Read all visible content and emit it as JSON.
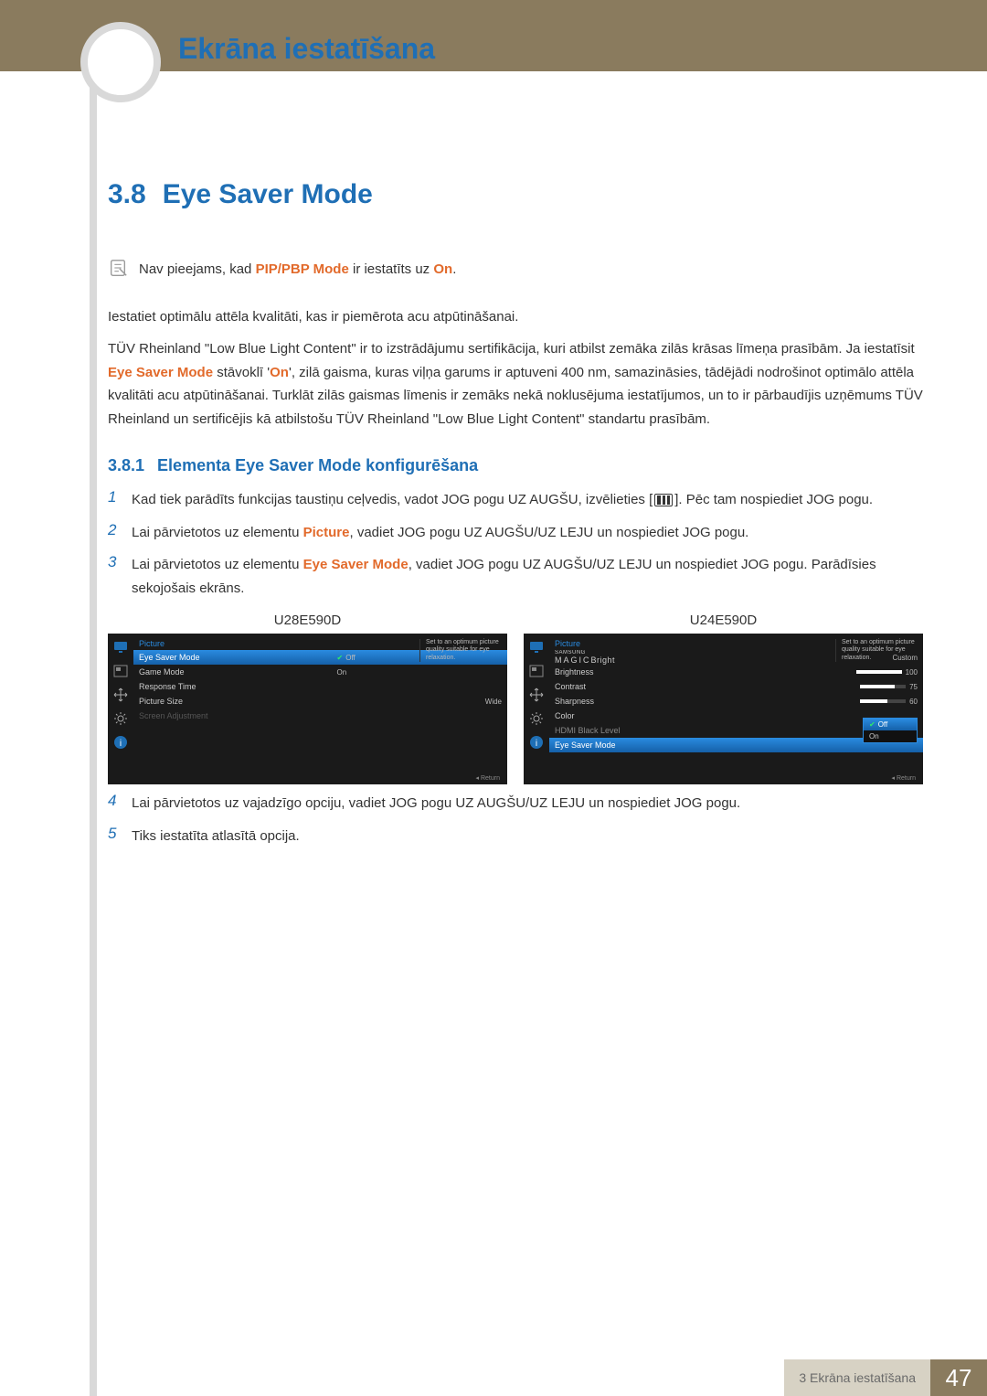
{
  "header": {
    "chapter_title": "Ekrāna iestatīšana"
  },
  "h2": {
    "num": "3.8",
    "title": "Eye Saver Mode"
  },
  "note": {
    "pre": "Nav pieejams, kad ",
    "bold1": "PIP/PBP Mode",
    "mid": " ir iestatīts uz ",
    "bold2": "On",
    "post": "."
  },
  "para1": "Iestatiet optimālu attēla kvalitāti, kas ir piemērota acu atpūtināšanai.",
  "para2": {
    "a": "TÜV Rheinland \"Low Blue Light Content\" ir to izstrādājumu sertifikācija, kuri atbilst zemāka zilās krāsas līmeņa prasībām. Ja iestatīsit ",
    "b": "Eye Saver Mode",
    "c": " stāvoklī '",
    "d": "On",
    "e": "', zilā gaisma, kuras viļņa garums ir aptuveni 400 nm, samazināsies, tādējādi nodrošinot optimālo attēla kvalitāti acu atpūtināšanai. Turklāt zilās gaismas līmenis ir zemāks nekā noklusējuma iestatījumos, un to ir pārbaudījis uzņēmums TÜV Rheinland un sertificējis kā atbilstošu TÜV Rheinland \"Low Blue Light Content\" standartu prasībām."
  },
  "h3": {
    "num": "3.8.1",
    "title": "Elementa Eye Saver Mode konfigurēšana"
  },
  "steps": {
    "s1a": "Kad tiek parādīts funkcijas taustiņu ceļvedis, vadot JOG pogu UZ AUGŠU, izvēlieties [",
    "s1b": "]. Pēc tam nospiediet JOG pogu.",
    "s2a": "Lai pārvietotos uz elementu ",
    "s2b": "Picture",
    "s2c": ", vadiet JOG pogu UZ AUGŠU/UZ LEJU un nospiediet JOG pogu.",
    "s3a": "Lai pārvietotos uz elementu ",
    "s3b": "Eye Saver Mode",
    "s3c": ", vadiet JOG pogu UZ AUGŠU/UZ LEJU un nospiediet JOG pogu. Parādīsies sekojošais ekrāns.",
    "s4": "Lai pārvietotos uz vajadzīgo opciju, vadiet JOG pogu UZ AUGŠU/UZ LEJU un nospiediet JOG pogu.",
    "s5": "Tiks iestatīta atlasītā opcija."
  },
  "osd": {
    "model1": "U28E590D",
    "model2": "U24E590D",
    "header": "Picture",
    "tip": "Set to an optimum picture quality suitable for eye relaxation.",
    "ret_label": "Return",
    "left": {
      "r1": "Eye Saver Mode",
      "v1": "Off",
      "r2": "Game Mode",
      "v2": "On",
      "r3": "Response Time",
      "r4": "Picture Size",
      "v4": "Wide",
      "r5": "Screen Adjustment"
    },
    "right": {
      "r1a": "SAMSUNG",
      "r1b": "MAGIC",
      "r1c": "Bright",
      "v1": "Custom",
      "r2": "Brightness",
      "v2": "100",
      "r3": "Contrast",
      "v3": "75",
      "r4": "Sharpness",
      "v4": "60",
      "r5": "Color",
      "r6": "HDMI Black Level",
      "r7": "Eye Saver Mode",
      "opt_off": "Off",
      "opt_on": "On"
    }
  },
  "footer": {
    "label": "3 Ekrāna iestatīšana",
    "page": "47"
  }
}
